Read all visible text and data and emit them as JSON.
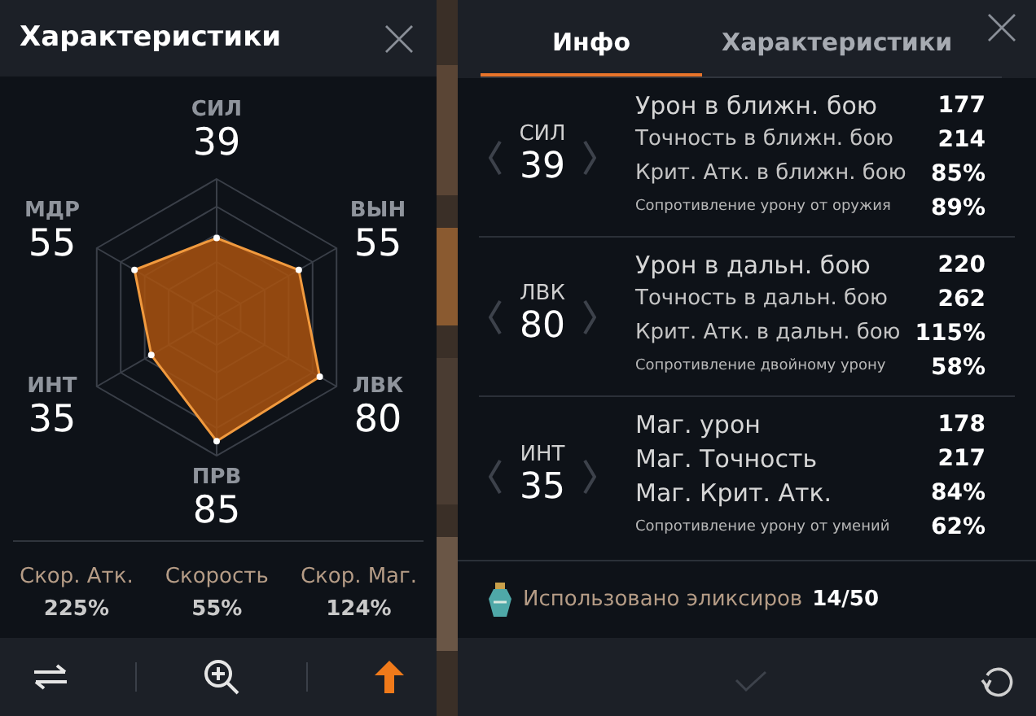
{
  "left_panel": {
    "title": "Характеристики",
    "stats": [
      {
        "name": "СИЛ",
        "value": "39"
      },
      {
        "name": "МДР",
        "value": "55"
      },
      {
        "name": "ВЫН",
        "value": "55"
      },
      {
        "name": "ИНТ",
        "value": "35"
      },
      {
        "name": "ЛВК",
        "value": "80"
      },
      {
        "name": "ПРВ",
        "value": "85"
      }
    ],
    "speeds": [
      {
        "label": "Скор. Атк.",
        "value": "225%"
      },
      {
        "label": "Скорость",
        "value": "55%"
      },
      {
        "label": "Скор. Маг.",
        "value": "124%"
      }
    ],
    "toolbar": [
      {
        "kind": "swap",
        "selected": false
      },
      {
        "kind": "zoom",
        "selected": false
      },
      {
        "kind": "upgrade",
        "selected": true
      }
    ]
  },
  "right_panel": {
    "tabs": [
      {
        "label": "Инфо",
        "selected": true
      },
      {
        "label": "Характеристики",
        "selected": false
      }
    ],
    "sections": [
      {
        "stat": "СИЛ",
        "value": "39",
        "rows": [
          {
            "label": "Урон в ближн. бою",
            "value": "177",
            "kind": "main"
          },
          {
            "label": "Точность в ближн. бою",
            "value": "214",
            "kind": "secondary"
          },
          {
            "label": "Крит. Атк. в ближн. бою",
            "value": "85%",
            "kind": "secondary"
          },
          {
            "label": "Сопротивление урону от оружия",
            "value": "89%",
            "kind": "note"
          }
        ]
      },
      {
        "stat": "ЛВК",
        "value": "80",
        "rows": [
          {
            "label": "Урон в дальн. бою",
            "value": "220",
            "kind": "main"
          },
          {
            "label": "Точность в дальн. бою",
            "value": "262",
            "kind": "secondary"
          },
          {
            "label": "Крит. Атк. в дальн. бою",
            "value": "115%",
            "kind": "secondary"
          },
          {
            "label": "Сопротивление двойному урону",
            "value": "58%",
            "kind": "note"
          }
        ]
      },
      {
        "stat": "ИНТ",
        "value": "35",
        "rows": [
          {
            "label": "Маг. урон",
            "value": "178",
            "kind": "main"
          },
          {
            "label": "Маг. Точность",
            "value": "217",
            "kind": "main"
          },
          {
            "label": "Маг. Крит. Атк.",
            "value": "84%",
            "kind": "main"
          },
          {
            "label": "Сопротивление урону от умений",
            "value": "62%",
            "kind": "note"
          }
        ]
      }
    ],
    "elixirs": {
      "label": "Использовано эликсиров",
      "value": "14/50"
    }
  }
}
